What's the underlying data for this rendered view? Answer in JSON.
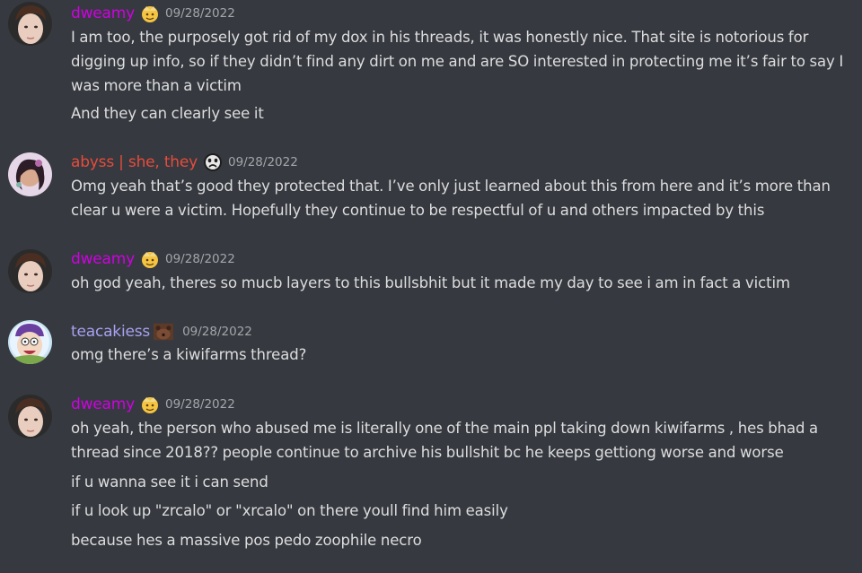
{
  "messages": [
    {
      "author": "dweamy",
      "author_color": "#d000e4",
      "badge_icon": "crown-food-icon",
      "timestamp": "09/28/2022",
      "lines": [
        "I am too, the purposely got rid of my dox in his threads, it was honestly nice. That site is notorious for digging up info, so if they didn’t find any dirt on me and are SO interested in protecting me it’s fair to say I was more than a victim",
        "And they can clearly see it"
      ]
    },
    {
      "author": "abyss | she, they",
      "author_color": "#e74c3c",
      "badge_icon": "crying-face-icon",
      "timestamp": "09/28/2022",
      "lines": [
        "Omg yeah that’s good they protected that. I’ve only just learned about this from here and it’s more than clear u were a victim. Hopefully they continue to be respectful of u and others impacted by this"
      ]
    },
    {
      "author": "dweamy",
      "author_color": "#d000e4",
      "badge_icon": "crown-food-icon",
      "timestamp": "09/28/2022",
      "lines": [
        "oh god yeah, theres so mucb layers to this bullsbhit but it made my day to see i am in fact a victim"
      ]
    },
    {
      "author": "teacakiess",
      "author_color": "#a7a1f0",
      "badge_icon": "bear-icon",
      "timestamp": "09/28/2022",
      "lines": [
        "omg there’s a kiwifarms thread?"
      ]
    },
    {
      "author": "dweamy",
      "author_color": "#d000e4",
      "badge_icon": "crown-food-icon",
      "timestamp": "09/28/2022",
      "lines": [
        "oh yeah, the person who abused me is literally one of the main ppl taking down kiwifarms , hes bhad a thread since 2018?? people continue to archive his bullshit bc he keeps gettiong worse and worse",
        "if u wanna see it i can send",
        "if u look up \"zrcalo\" or \"xrcalo\" on there youll find him easily",
        "because hes a massive pos pedo zoophile necro"
      ]
    }
  ]
}
